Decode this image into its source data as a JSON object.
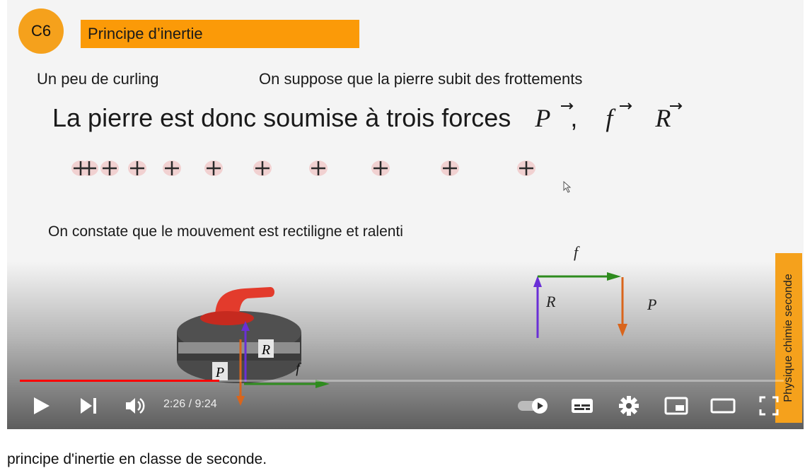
{
  "slide": {
    "badge": "C6",
    "title": "Principe d’inertie",
    "intro": "Un peu de curling",
    "hypothesis": "On suppose que la pierre subit des  frottements",
    "forces_sentence": "La pierre est donc soumise à trois forces",
    "vector_P": "P",
    "vector_f": "f",
    "vector_R": "R",
    "comma": ",",
    "observation": "On constate que le mouvement est rectiligne et ralenti",
    "diagram_labels": {
      "f": "f",
      "R": "R",
      "P": "P"
    },
    "stone_labels": {
      "R": "R",
      "P": "P",
      "f": "f"
    },
    "side_tab": "Physique chimie seconde"
  },
  "colors": {
    "accent_orange": "#fb9a08",
    "progress_red": "#ff0000",
    "R_arrow": "#6a2fd6",
    "f_arrow": "#2e8b1e",
    "P_arrow": "#d9651c",
    "stone_handle": "#e33b2c"
  },
  "player": {
    "time": "2:26 / 9:24",
    "progress_fraction": 0.26,
    "icons": [
      "play-icon",
      "next-icon",
      "volume-icon",
      "autoplay-toggle-icon",
      "subtitles-icon",
      "settings-icon",
      "miniplayer-icon",
      "theater-icon",
      "fullscreen-icon"
    ]
  },
  "caption": "principe d'inertie en classe de seconde."
}
